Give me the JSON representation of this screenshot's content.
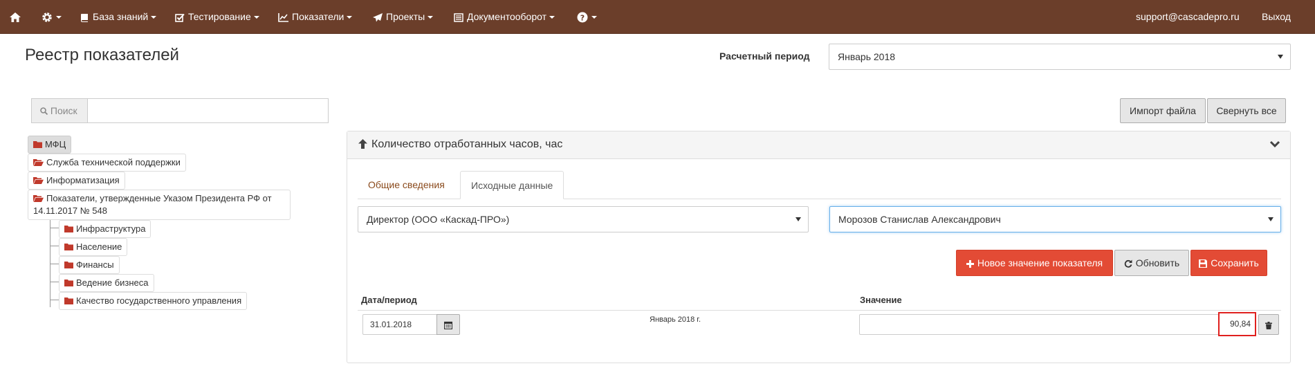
{
  "nav": {
    "items": [
      {
        "label": "База знаний"
      },
      {
        "label": "Тестирование"
      },
      {
        "label": "Показатели"
      },
      {
        "label": "Проекты"
      },
      {
        "label": "Документооборот"
      }
    ],
    "user_email": "support@cascadepro.ru",
    "logout_label": "Выход"
  },
  "header": {
    "title": "Реестр показателей",
    "period_label": "Расчетный период",
    "period_value": "Январь 2018"
  },
  "search": {
    "addon_label": "Поиск",
    "value": ""
  },
  "tree": {
    "items": [
      {
        "label": "МФЦ"
      },
      {
        "label": "Служба технической поддержки"
      },
      {
        "label": "Информатизация"
      },
      {
        "label": "Показатели, утвержденные Указом Президента РФ от",
        "label2": "14.11.2017 № 548"
      }
    ],
    "children": [
      {
        "label": "Инфраструктура"
      },
      {
        "label": "Население"
      },
      {
        "label": "Финансы"
      },
      {
        "label": "Ведение бизнеса"
      },
      {
        "label": "Качество государственного управления"
      }
    ]
  },
  "toolbar": {
    "import_label": "Импорт файла",
    "collapse_label": "Свернуть все"
  },
  "panel": {
    "title": "Количество отработанных часов, час",
    "tabs": [
      {
        "label": "Общие сведения"
      },
      {
        "label": "Исходные данные"
      }
    ],
    "position_select": "Директор (ООО «Каскад-ПРО»)",
    "person_select": "Морозов Станислав Александрович",
    "buttons": {
      "new_value": "Новое значение показателя",
      "refresh": "Обновить",
      "save": "Сохранить"
    },
    "table": {
      "headers": {
        "date": "Дата/период",
        "value": "Значение"
      },
      "row": {
        "date": "31.01.2018",
        "period": "Январь 2018 г.",
        "value": "90,84"
      }
    }
  },
  "colors": {
    "navbar": "#6b3e2a",
    "accent": "#e34b35",
    "folder": "#c0392b",
    "link": "#8a4a1c",
    "highlight": "#e0201e"
  }
}
